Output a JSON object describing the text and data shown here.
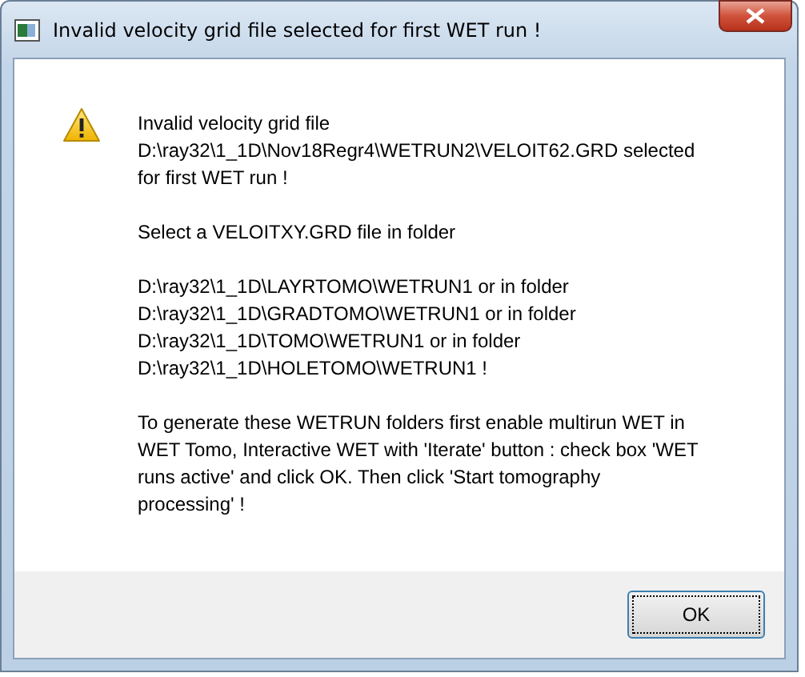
{
  "window": {
    "title": "Invalid velocity grid file selected for first WET run !"
  },
  "message": [
    {
      "lines": [
        "Invalid velocity grid file",
        "D:\\ray32\\1_1D\\Nov18Regr4\\WETRUN2\\VELOIT62.GRD selected",
        "for first WET run !"
      ]
    },
    {
      "lines": [
        "Select a VELOITXY.GRD file in folder"
      ]
    },
    {
      "lines": [
        "D:\\ray32\\1_1D\\LAYRTOMO\\WETRUN1 or in folder",
        "D:\\ray32\\1_1D\\GRADTOMO\\WETRUN1 or in folder",
        "D:\\ray32\\1_1D\\TOMO\\WETRUN1 or in folder",
        "D:\\ray32\\1_1D\\HOLETOMO\\WETRUN1 !"
      ]
    },
    {
      "lines": [
        "To generate these WETRUN folders first enable multirun WET in",
        "WET Tomo, Interactive WET with 'Iterate' button : check box 'WET",
        "runs active' and click OK. Then click 'Start tomography",
        "processing' !"
      ]
    }
  ],
  "buttons": [
    {
      "label": "OK",
      "focused": true
    }
  ]
}
